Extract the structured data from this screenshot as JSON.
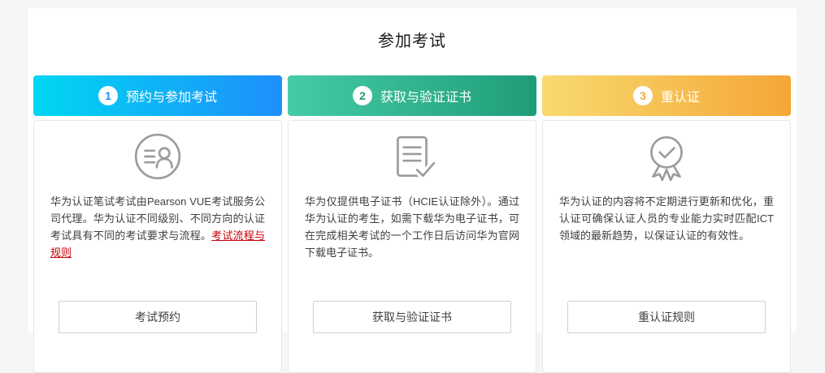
{
  "page": {
    "title": "参加考试"
  },
  "colors": {
    "gradient_blue": [
      "#00d7f2",
      "#1e8ffb"
    ],
    "gradient_green": [
      "#45cba7",
      "#1f9d78"
    ],
    "gradient_orange": [
      "#f8da70",
      "#f5a637"
    ],
    "link_red": "#c7000b",
    "icon_gray": "#9c9c9c",
    "page_background": "#f5f6f8"
  },
  "columns": [
    {
      "step": "1",
      "header": "预约与参加考试",
      "icon": "profile-list-circle-icon",
      "text": "华为认证笔试考试由Pearson VUE考试服务公司代理。华为认证不同级别、不同方向的认证考试具有不同的考试要求与流程。",
      "link": "考试流程与规则",
      "button": "考试预约"
    },
    {
      "step": "2",
      "header": "获取与验证证书",
      "icon": "document-check-icon",
      "text": "华为仅提供电子证书（HCIE认证除外）。通过华为认证的考生，如需下载华为电子证书，可在完成相关考试的一个工作日后访问华为官网下载电子证书。",
      "link": "",
      "button": "获取与验证证书"
    },
    {
      "step": "3",
      "header": "重认证",
      "icon": "badge-check-icon",
      "text": "华为认证的内容将不定期进行更新和优化，重认证可确保认证人员的专业能力实时匹配ICT领域的最新趋势，以保证认证的有效性。",
      "link": "",
      "button": "重认证规则"
    }
  ]
}
